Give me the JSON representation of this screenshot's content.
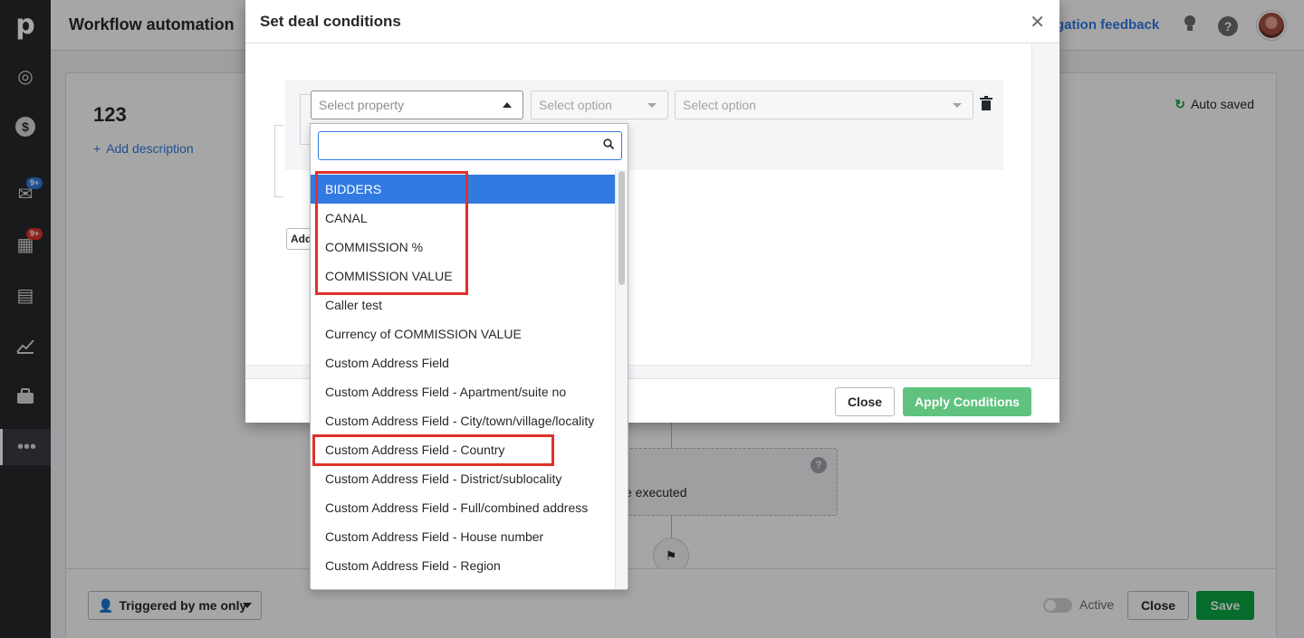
{
  "rail": {
    "logo": "p",
    "items": [
      {
        "icon": "target-icon",
        "glyph": "◎"
      },
      {
        "icon": "dollar-icon",
        "glyph": "$"
      },
      {
        "icon": "mail-icon",
        "glyph": "✉",
        "badge": "9+",
        "badge_color": "#317ae2"
      },
      {
        "icon": "calendar-icon",
        "glyph": "▦",
        "badge": "9+",
        "badge_color": "#e0312b"
      },
      {
        "icon": "contacts-icon",
        "glyph": "▤"
      },
      {
        "icon": "chart-icon",
        "glyph": "⟋"
      },
      {
        "icon": "products-icon",
        "glyph": "▬"
      },
      {
        "icon": "more-icon",
        "glyph": "•••"
      }
    ]
  },
  "topbar": {
    "title": "Workflow automation",
    "feedback": "gation feedback"
  },
  "workflow": {
    "name": "123",
    "add_description": "Add description",
    "autosaved": "Auto saved",
    "executed_text": "e executed",
    "trigger_label": "Triggered by me only",
    "active_label": "Active",
    "close_label": "Close",
    "save_label": "Save"
  },
  "modal": {
    "title": "Set deal conditions",
    "property_placeholder": "Select property",
    "option_placeholder_1": "Select option",
    "option_placeholder_2": "Select option",
    "add_label": "Add",
    "close_label": "Close",
    "apply_label": "Apply Conditions"
  },
  "dropdown": {
    "search_value": "",
    "options": [
      {
        "label": "BIDDERS",
        "selected": true
      },
      {
        "label": "CANAL",
        "selected": false
      },
      {
        "label": "COMMISSION %",
        "selected": false
      },
      {
        "label": "COMMISSION VALUE",
        "selected": false
      },
      {
        "label": "Caller test",
        "selected": false
      },
      {
        "label": "Currency of COMMISSION VALUE",
        "selected": false
      },
      {
        "label": "Custom Address Field",
        "selected": false
      },
      {
        "label": "Custom Address Field - Apartment/suite no",
        "selected": false
      },
      {
        "label": "Custom Address Field - City/town/village/locality",
        "selected": false
      },
      {
        "label": "Custom Address Field - Country",
        "selected": false
      },
      {
        "label": "Custom Address Field - District/sublocality",
        "selected": false
      },
      {
        "label": "Custom Address Field - Full/combined address",
        "selected": false
      },
      {
        "label": "Custom Address Field - House number",
        "selected": false
      },
      {
        "label": "Custom Address Field - Region",
        "selected": false
      }
    ]
  },
  "colors": {
    "accent_blue": "#317ae2",
    "save_green": "#08a742",
    "highlight_red": "#e0312b",
    "rail_bg": "#26292c"
  }
}
